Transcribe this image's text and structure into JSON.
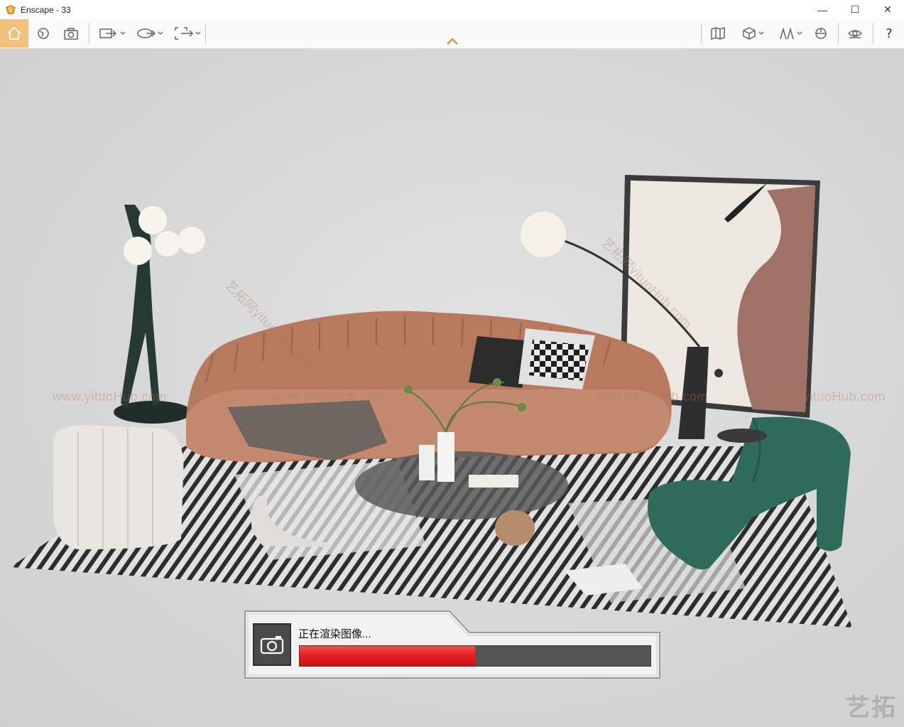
{
  "window": {
    "title": "Enscape - 33",
    "minimize_glyph": "—",
    "maximize_glyph": "☐",
    "close_glyph": "✕"
  },
  "toolbar": {
    "left_buttons": [
      "home-icon",
      "orbit-icon",
      "screenshot-icon",
      "render-video-icon",
      "panorama-icon",
      "batch-render-icon"
    ],
    "right_buttons": [
      "map-icon",
      "view-cube-icon",
      "atmosphere-icon",
      "visual-settings-icon",
      "eye-icon"
    ],
    "help_label": "?"
  },
  "watermarks": [
    "www.yituoHub.com",
    "www.yituoHub.com",
    "www.yituoHub.com",
    "www.yituoHub.com",
    "艺拓网yituoHub.com",
    "艺拓网yituoHub.com"
  ],
  "render": {
    "label": "正在渲染图像...",
    "progress": 0.5
  },
  "logo": "艺拓",
  "colors": {
    "accent_home": "#f1c07a",
    "progress_red": "#e21f1f",
    "caret_orange": "#d9892a"
  }
}
